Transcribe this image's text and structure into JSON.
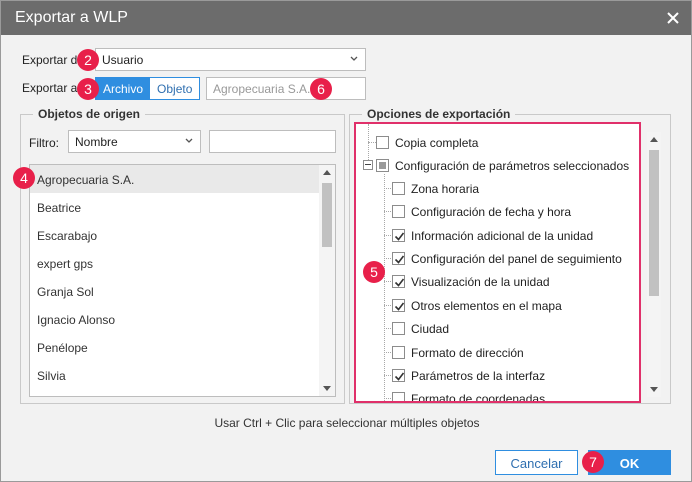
{
  "window": {
    "title": "Exportar a WLP"
  },
  "export_from": {
    "label": "Exportar d",
    "value": "Usuario"
  },
  "export_to": {
    "label": "Exportar a",
    "options": [
      "Archivo",
      "Objeto"
    ],
    "selected": "Archivo",
    "placeholder": "Agropecuaria S.A."
  },
  "source_objects": {
    "legend": "Objetos de origen",
    "filter_label": "Filtro:",
    "filter_field": "Nombre",
    "filter_value": "",
    "items": [
      "Agropecuaria S.A.",
      "Beatrice",
      "Escarabajo",
      "expert gps",
      "Granja Sol",
      "Ignacio Alonso",
      "Penélope",
      "Silvia"
    ],
    "selected_index": 0
  },
  "export_options": {
    "legend": "Opciones de exportación",
    "items": [
      {
        "label": "Copia completa",
        "checked": false,
        "level": 0
      },
      {
        "label": "Configuración de parámetros seleccionados",
        "checked": "partial",
        "level": 0
      },
      {
        "label": "Zona horaria",
        "checked": false,
        "level": 1
      },
      {
        "label": "Configuración de fecha y hora",
        "checked": false,
        "level": 1
      },
      {
        "label": "Información adicional de la unidad",
        "checked": true,
        "level": 1
      },
      {
        "label": "Configuración del panel de seguimiento",
        "checked": true,
        "level": 1
      },
      {
        "label": "Visualización de la unidad",
        "checked": true,
        "level": 1
      },
      {
        "label": "Otros elementos en el mapa",
        "checked": true,
        "level": 1
      },
      {
        "label": "Ciudad",
        "checked": false,
        "level": 1
      },
      {
        "label": "Formato de dirección",
        "checked": false,
        "level": 1
      },
      {
        "label": "Parámetros de la interfaz",
        "checked": true,
        "level": 1
      },
      {
        "label": "Formato de coordenadas",
        "checked": false,
        "level": 1
      }
    ]
  },
  "hint": "Usar Ctrl + Clic para seleccionar múltiples objetos",
  "buttons": {
    "cancel": "Cancelar",
    "ok": "OK"
  },
  "badges": [
    "2",
    "3",
    "4",
    "5",
    "6",
    "7"
  ],
  "colors": {
    "accent": "#2f8ee0",
    "badge": "#e8204a",
    "highlight_border": "#e0306a",
    "titlebar": "#6c6c6c"
  }
}
